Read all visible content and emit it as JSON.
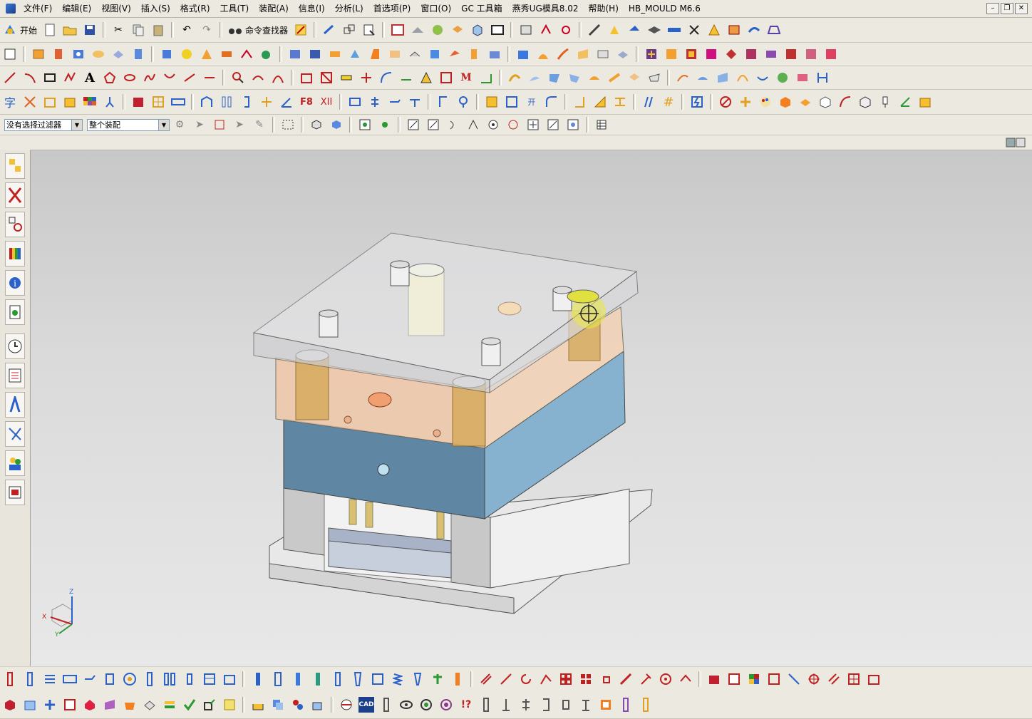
{
  "menu": [
    {
      "label": "文件(F)"
    },
    {
      "label": "编辑(E)"
    },
    {
      "label": "视图(V)"
    },
    {
      "label": "插入(S)"
    },
    {
      "label": "格式(R)"
    },
    {
      "label": "工具(T)"
    },
    {
      "label": "装配(A)"
    },
    {
      "label": "信息(I)"
    },
    {
      "label": "分析(L)"
    },
    {
      "label": "首选项(P)"
    },
    {
      "label": "窗口(O)"
    },
    {
      "label": "GC 工具箱"
    },
    {
      "label": "燕秀UG模具8.02"
    },
    {
      "label": "帮助(H)"
    },
    {
      "label": "HB_MOULD M6.6"
    }
  ],
  "toolbar1": {
    "start_label": "开始",
    "command_finder_label": "命令查找器"
  },
  "selection": {
    "filter_value": "没有选择过滤器",
    "scope_value": "整个装配"
  },
  "triad": {
    "z": "Z",
    "x": "X",
    "y": "Y"
  },
  "colors": {
    "plate_top": "rgba(220,220,225,0.55)",
    "plate_orange": "#f2c9a8",
    "plate_blue": "#7fa8c4",
    "accent": "#e8e64a"
  }
}
